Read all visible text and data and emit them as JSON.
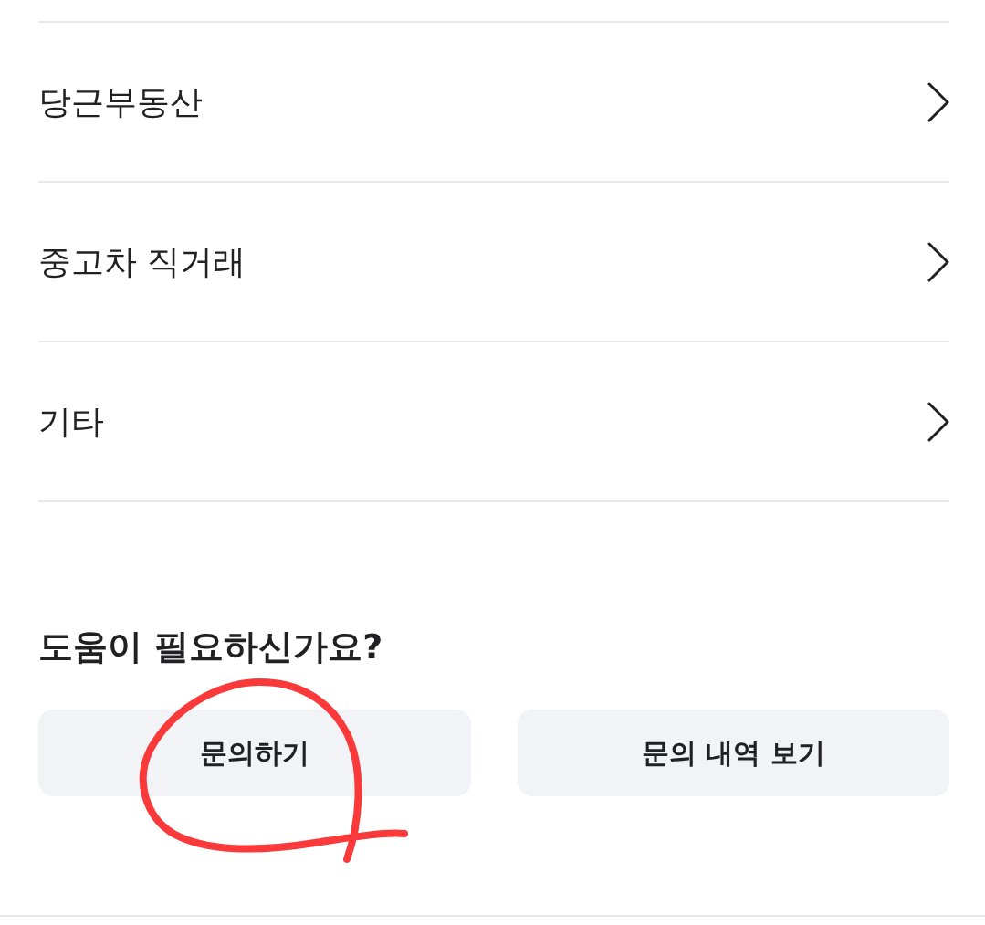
{
  "menu_items": [
    {
      "label": "당근부동산"
    },
    {
      "label": "중고차 직거래"
    },
    {
      "label": "기타"
    }
  ],
  "help": {
    "title": "도움이 필요하신가요?",
    "buttons": [
      {
        "label": "문의하기",
        "circled": true
      },
      {
        "label": "문의 내역 보기",
        "circled": false
      }
    ]
  }
}
